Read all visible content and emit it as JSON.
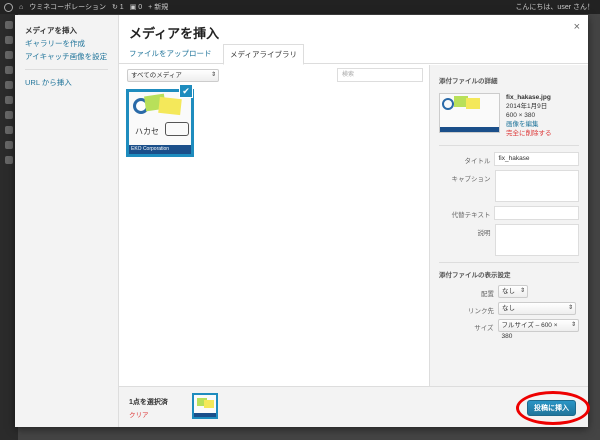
{
  "admin_bar": {
    "site_name": "ウミネコーポレーション",
    "updates": "1",
    "comments": "0",
    "new_label": "+ 新規",
    "greeting": "こんにちは、user さん！"
  },
  "menu": {
    "items": [
      {
        "label": "メディアを挿入",
        "active": true
      },
      {
        "label": "ギャラリーを作成",
        "active": false
      },
      {
        "label": "アイキャッチ画像を設定",
        "active": false
      }
    ],
    "url_insert": "URL から挿入"
  },
  "modal": {
    "title": "メディアを挿入",
    "close_glyph": "×",
    "tabs": [
      {
        "label": "ファイルをアップロード",
        "active": false
      },
      {
        "label": "メディアライブラリ",
        "active": true
      }
    ]
  },
  "browser": {
    "filter_value": "すべてのメディア",
    "search_placeholder": "検索",
    "attachment": {
      "caption": "ハカセ",
      "banner": "EKO Corporation"
    }
  },
  "details": {
    "heading": "添付ファイルの詳細",
    "filename": "fix_hakase.jpg",
    "date": "2014年1月9日",
    "dimensions": "600 × 380",
    "edit_link": "画像を編集",
    "delete_link": "完全に削除する",
    "fields": {
      "title_label": "タイトル",
      "title_value": "fix_hakase",
      "caption_label": "キャプション",
      "alt_label": "代替テキスト",
      "desc_label": "説明"
    }
  },
  "display_settings": {
    "heading": "添付ファイルの表示設定",
    "align_label": "配置",
    "align_value": "なし",
    "link_label": "リンク先",
    "link_value": "なし",
    "size_label": "サイズ",
    "size_value": "フルサイズ – 600 × 380"
  },
  "toolbar": {
    "selected_count": "1点を選択済",
    "clear_label": "クリア",
    "insert_label": "投稿に挿入"
  },
  "colors": {
    "accent": "#1e8cbe",
    "link": "#21759b",
    "danger": "#dd3333",
    "highlight_ring": "#ee0000"
  }
}
